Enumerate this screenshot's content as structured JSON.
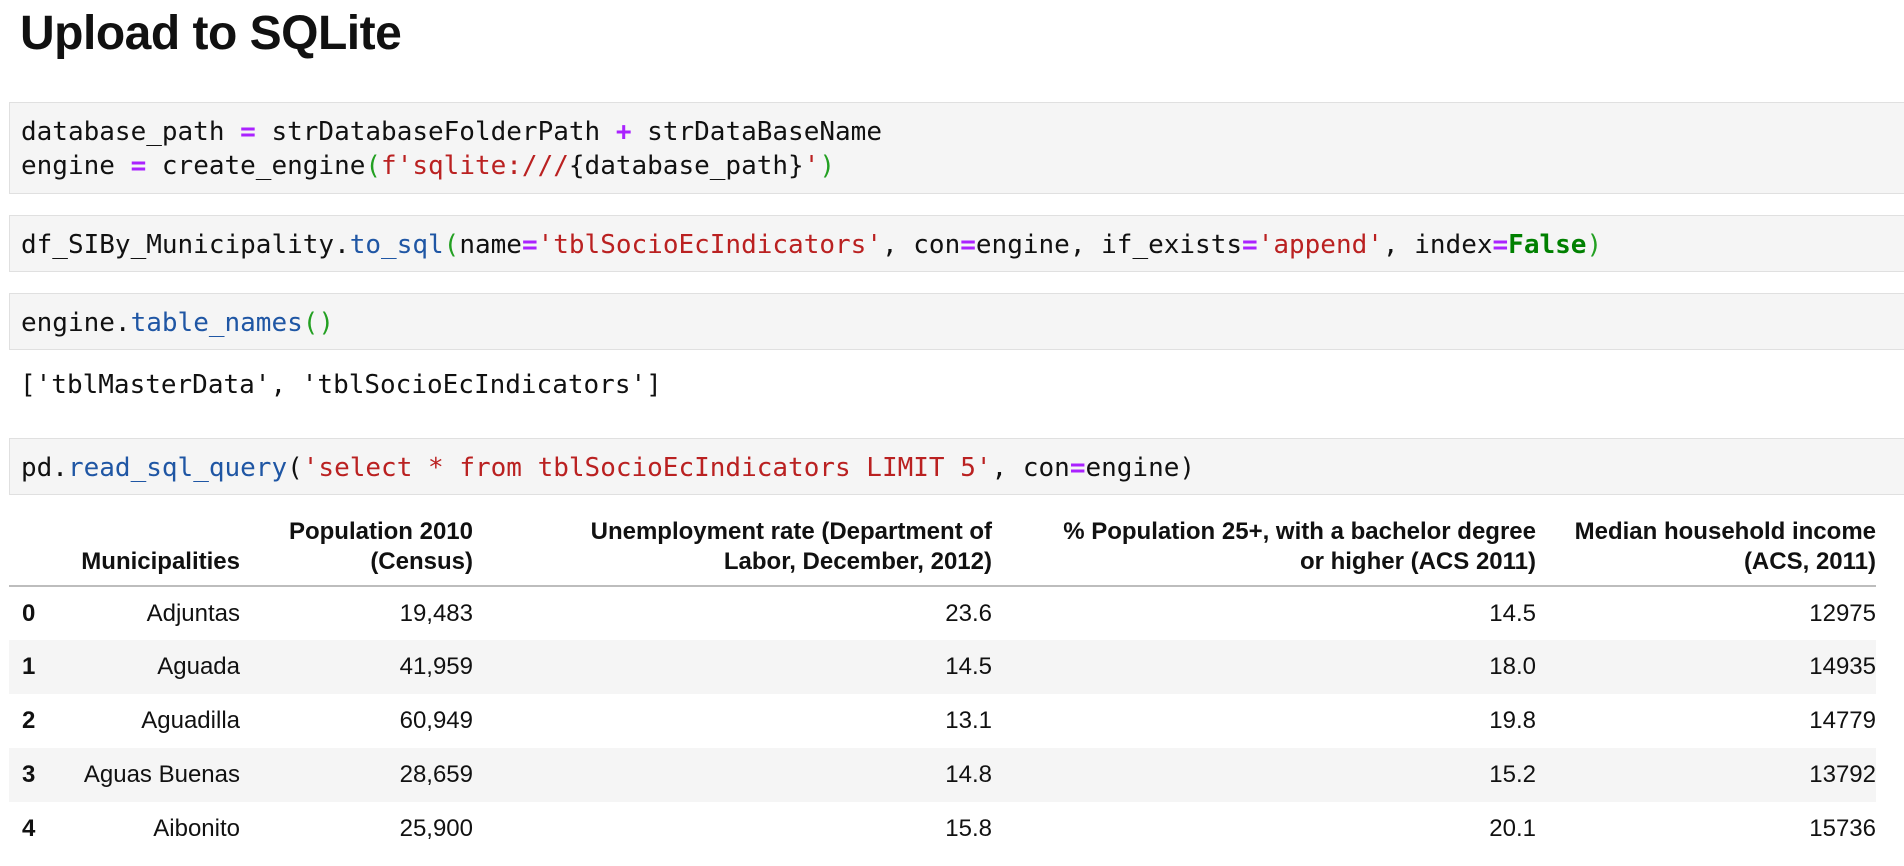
{
  "heading": "Upload to SQLite",
  "cell1": {
    "line1": {
      "a": "database_path",
      "op1": "=",
      "b": "strDatabaseFolderPath",
      "op2": "+",
      "c": "strDataBaseName"
    },
    "line2": {
      "a": "engine",
      "op1": "=",
      "fn": "create_engine",
      "paren_open": "(",
      "str_start": "f'sqlite:///",
      "expr": "{database_path}",
      "str_end": "'",
      "paren_close": ")"
    }
  },
  "cell2": {
    "obj": "df_SIBy_Municipality.",
    "fn": "to_sql",
    "paren_open": "(",
    "arg1_name": "name",
    "eq": "=",
    "arg1_val": "'tblSocioEcIndicators'",
    "sep": ", ",
    "arg2_name": "con",
    "arg2_val": "engine",
    "arg3_name": "if_exists",
    "arg3_val": "'append'",
    "arg4_name": "index",
    "arg4_val": "False",
    "paren_close": ")"
  },
  "cell3": {
    "obj": "engine.",
    "fn": "table_names",
    "parens": "()"
  },
  "output3": "['tblMasterData', 'tblSocioEcIndicators']",
  "cell4": {
    "obj": "pd.",
    "fn": "read_sql_query",
    "paren_open": "(",
    "query": "'select * from tblSocioEcIndicators LIMIT 5'",
    "sep": ", ",
    "arg_name": "con",
    "eq": "=",
    "arg_val": "engine",
    "paren_close": ")"
  },
  "dataframe": {
    "columns": {
      "municipalities": "Municipalities",
      "population_l1": "Population 2010",
      "population_l2": "(Census)",
      "unemployment_l1": "Unemployment rate (Department of",
      "unemployment_l2": "Labor, December, 2012)",
      "bachelor_l1": "% Population 25+, with a bachelor degree",
      "bachelor_l2": "or higher (ACS 2011)",
      "income_l1": "Median household income",
      "income_l2": "(ACS, 2011)"
    },
    "rows": [
      {
        "index": "0",
        "municipality": "Adjuntas",
        "population": "19,483",
        "unemployment": "23.6",
        "bachelor": "14.5",
        "income": "12975"
      },
      {
        "index": "1",
        "municipality": "Aguada",
        "population": "41,959",
        "unemployment": "14.5",
        "bachelor": "18.0",
        "income": "14935"
      },
      {
        "index": "2",
        "municipality": "Aguadilla",
        "population": "60,949",
        "unemployment": "13.1",
        "bachelor": "19.8",
        "income": "14779"
      },
      {
        "index": "3",
        "municipality": "Aguas Buenas",
        "population": "28,659",
        "unemployment": "14.8",
        "bachelor": "15.2",
        "income": "13792"
      },
      {
        "index": "4",
        "municipality": "Aibonito",
        "population": "25,900",
        "unemployment": "15.8",
        "bachelor": "20.1",
        "income": "15736"
      }
    ]
  },
  "colors": {
    "operator": "#aa22ff",
    "string": "#ba2121",
    "function": "#1f56a4",
    "paren": "#23a022",
    "keyword": "#008000",
    "cell_background": "#f5f5f5",
    "table_stripe": "#f5f5f5"
  }
}
